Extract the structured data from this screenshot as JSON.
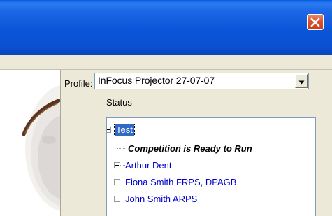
{
  "window": {
    "close_icon": "close-x-icon",
    "colors": {
      "title_bar": "#0a50d0",
      "close_button": "#d9542e",
      "face": "#ece9d8"
    }
  },
  "form": {
    "profile_label": "Profile:",
    "profile_value": "InFocus Projector 27-07-07",
    "status_label": "Status"
  },
  "tree": {
    "root": {
      "label": "Test",
      "expander": "minus"
    },
    "status_message": "Competition is Ready to Run",
    "entrants": [
      {
        "label": "Arthur Dent",
        "expander": "plus"
      },
      {
        "label": "Fiona Smith FRPS, DPAGB",
        "expander": "plus"
      },
      {
        "label": "John Smith ARPS",
        "expander": "plus"
      }
    ],
    "colors": {
      "selection": "#316ac5",
      "entrant_text": "#0000cc"
    }
  }
}
